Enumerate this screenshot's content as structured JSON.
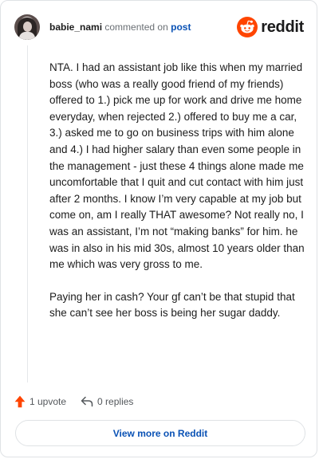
{
  "header": {
    "username": "babie_nami",
    "commented_on_text": "commented on",
    "post_link_label": "post",
    "brand_label": "reddit"
  },
  "comment": {
    "paragraphs": [
      "NTA. I had an assistant job like this when my married boss (who was a really good friend of my friends) offered to 1.) pick me up for work and drive me home everyday, when rejected 2.) offered to buy me a car, 3.) asked me to go on business trips with him alone and 4.) I had higher salary than even some people in the management - just these 4 things alone made me uncomfortable that I quit and cut contact with him just after 2 months. I know I’m very capable at my job but come on, am I really THAT awesome? Not really no, I was an assistant, I’m not “making banks” for him. he was in also in his mid 30s, almost 10 years older than me which was very gross to me.",
      "Paying her in cash? Your gf can’t be that stupid that she can’t see her boss is being her sugar daddy."
    ]
  },
  "actions": {
    "upvote_label": "1 upvote",
    "replies_label": "0 replies"
  },
  "footer": {
    "view_more_label": "View more on Reddit"
  },
  "colors": {
    "reddit_orange": "#ff4500",
    "link_blue": "#0a52b5",
    "muted_text": "#6a6f74"
  },
  "icons": [
    "avatar",
    "reddit-logo-icon",
    "upvote-arrow-icon",
    "reply-arrow-icon"
  ]
}
